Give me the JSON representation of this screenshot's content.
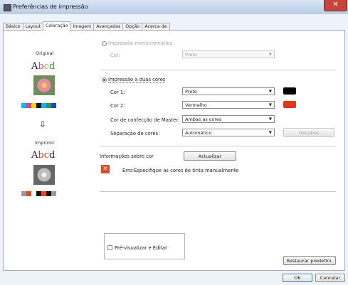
{
  "window": {
    "title": "Preferências de impressão",
    "close_glyph": "✕"
  },
  "tabs": [
    "Básico",
    "Layout",
    "Coloração",
    "Imagem",
    "Avançadas",
    "Opção",
    "Acerca de"
  ],
  "preview": {
    "original_label": "Original",
    "print_label": "Imprimir",
    "sample_text": [
      "A",
      "b",
      "c",
      "d"
    ],
    "arrow": "⇩",
    "original_swatches": [
      "#1ab0e8",
      "#d63fa8",
      "#f0d10f",
      "#111111",
      "#1ab0e8",
      "#2e9a3f",
      "#2444b8"
    ],
    "print_swatches": [
      "#9a9a9a",
      "#e04a1c",
      "#ffffff",
      "#111111",
      "#e04a1c",
      "#111111",
      "#9a9a9a"
    ]
  },
  "mono": {
    "label": "Impressão monocromática",
    "color_label": "Cor:",
    "color_value": "Preto"
  },
  "two_color": {
    "label": "Impressão a duas cores",
    "color1_label": "Cor 1:",
    "color1_value": "Preto",
    "color1_swatch": "#000000",
    "color2_label": "Cor 2:",
    "color2_value": "Vermelho",
    "color2_swatch": "#e0361c",
    "master_label": "Cor de confecção de Master:",
    "master_value": "Ambas as cores",
    "separation_label": "Separação de cores:",
    "separation_value": "Automático",
    "details_button": "Detalhes"
  },
  "color_info": {
    "label": "Informações sobre cor",
    "update_button": "Actualizar",
    "error_icon": "error-icon",
    "error_text": "Erro:Especifique as cores de tinta manualmente"
  },
  "preview_edit": {
    "label": "Pré-visualizar e Editar"
  },
  "restore_button": "Restaurar predefini.",
  "ok_button": "OK",
  "cancel_button": "Cancelar"
}
